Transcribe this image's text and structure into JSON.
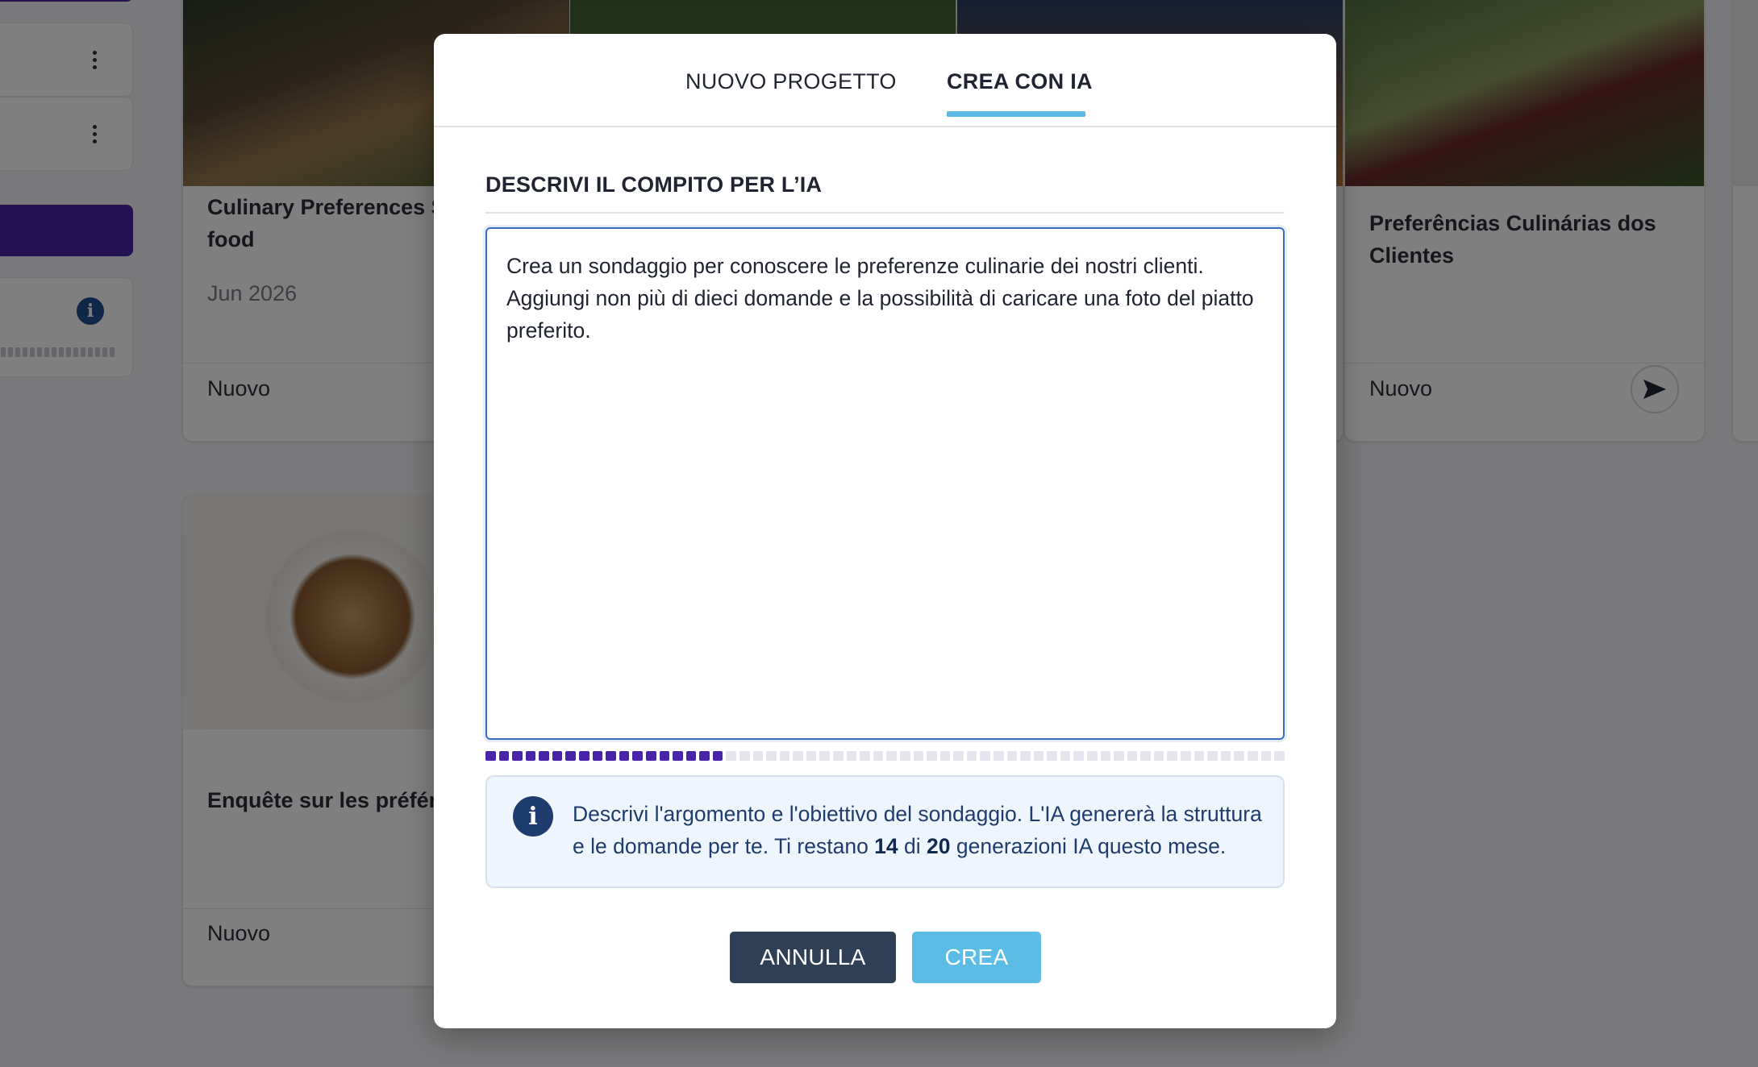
{
  "background": {
    "cards": [
      {
        "title": "Culinary Preferences S Drink and food",
        "date": "Jun 2026",
        "status": "Nuovo"
      },
      {
        "title": "Preferências Culinárias dos Clientes",
        "status": "Nuovo"
      },
      {
        "title": "Enquête sur les préfére culinaires",
        "status": "Nuovo"
      }
    ]
  },
  "modal": {
    "tabs": [
      {
        "label": "NUOVO PROGETTO",
        "active": false
      },
      {
        "label": "CREA CON IA",
        "active": true
      }
    ],
    "section_title": "DESCRIVI IL COMPITO PER L’IA",
    "prompt_text": "Crea un sondaggio per conoscere le preferenze culinarie dei nostri clienti. Aggiungi non più di dieci domande e la possibilità di caricare una foto del piatto preferito.",
    "char_meter": {
      "filled_fraction": 0.3
    },
    "info": {
      "text_before": "Descrivi l'argomento e l'obiettivo del sondaggio. L'IA genererà la struttura e le domande per te. Ti restano ",
      "remaining": "14",
      "text_mid": " di ",
      "total": "20",
      "text_after": " generazioni IA questo mese."
    },
    "buttons": {
      "cancel": "ANNULLA",
      "create": "CREA"
    },
    "colors": {
      "accent_tab": "#5bb9e3",
      "cancel": "#2f3f56",
      "create": "#5bbde6",
      "meter": "#4a24a8"
    }
  }
}
